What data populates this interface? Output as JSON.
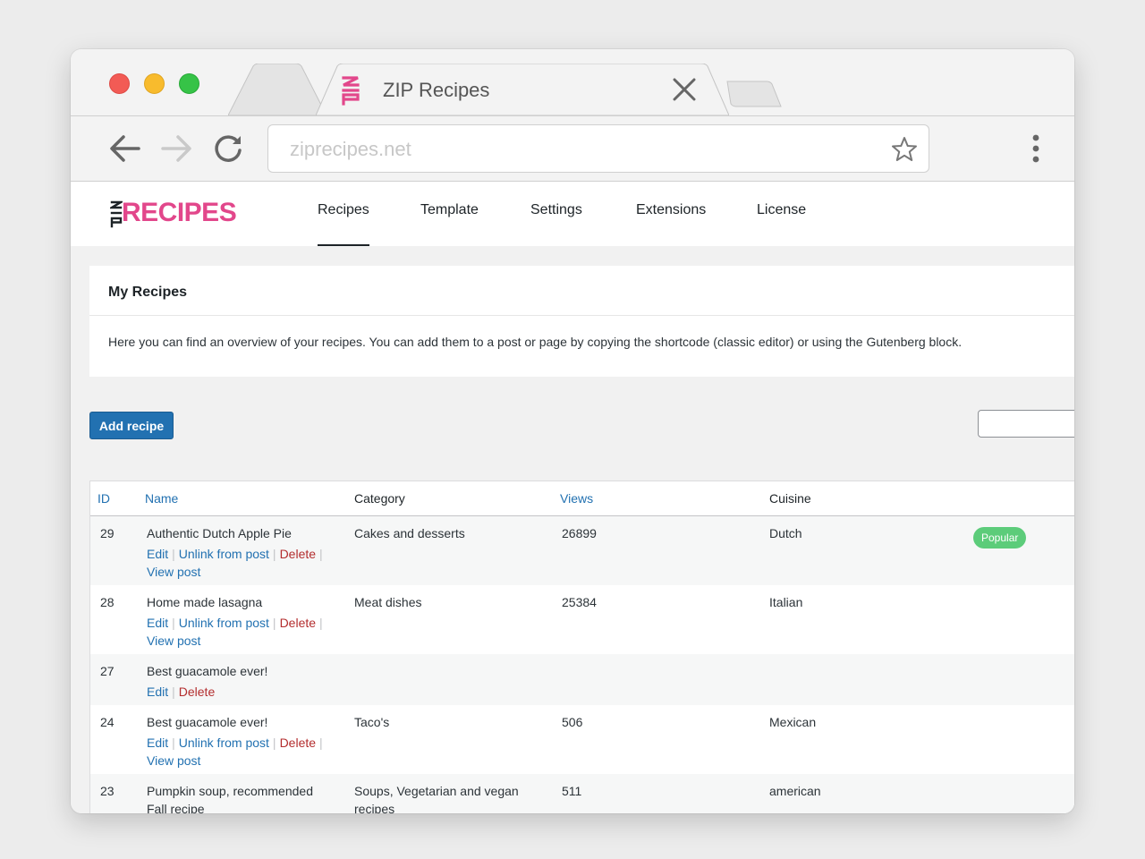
{
  "browser": {
    "tab_title": "ZIP Recipes",
    "address_placeholder": "ziprecipes.net"
  },
  "brand": {
    "logo_text": "RECIPES",
    "logo_mark": "ZIP"
  },
  "nav": {
    "tabs": [
      {
        "label": "Recipes",
        "active": true
      },
      {
        "label": "Template",
        "active": false
      },
      {
        "label": "Settings",
        "active": false
      },
      {
        "label": "Extensions",
        "active": false
      },
      {
        "label": "License",
        "active": false
      }
    ]
  },
  "panel": {
    "title": "My Recipes",
    "description": "Here you can find an overview of your recipes. You can add them to a post or page by copying the shortcode (classic editor) or using the Gutenberg block."
  },
  "toolbar": {
    "add_label": "Add recipe"
  },
  "table": {
    "headers": {
      "id": "ID",
      "name": "Name",
      "category": "Category",
      "views": "Views",
      "cuisine": "Cuisine"
    },
    "action_labels": {
      "edit": "Edit",
      "unlink": "Unlink from post",
      "delete": "Delete",
      "view": "View post"
    },
    "rows": [
      {
        "id": "29",
        "name": "Authentic Dutch Apple Pie",
        "category": "Cakes and desserts",
        "views": "26899",
        "cuisine": "Dutch",
        "badge": "Popular"
      },
      {
        "id": "28",
        "name": "Home made lasagna",
        "category": "Meat dishes",
        "views": "25384",
        "cuisine": "Italian"
      },
      {
        "id": "27",
        "name": "Best guacamole ever!",
        "category": "",
        "views": "",
        "cuisine": ""
      },
      {
        "id": "24",
        "name": "Best guacamole ever!",
        "category": "Taco's",
        "views": "506",
        "cuisine": "Mexican"
      },
      {
        "id": "23",
        "name": "Pumpkin soup, recommended Fall recipe",
        "category": "Soups, Vegetarian and vegan recipes",
        "views": "511",
        "cuisine": "american"
      }
    ]
  },
  "colors": {
    "brand_pink": "#e2478b",
    "wp_blue": "#2271b1",
    "delete_red": "#b32d2e",
    "badge_green": "#5ccc7a"
  }
}
